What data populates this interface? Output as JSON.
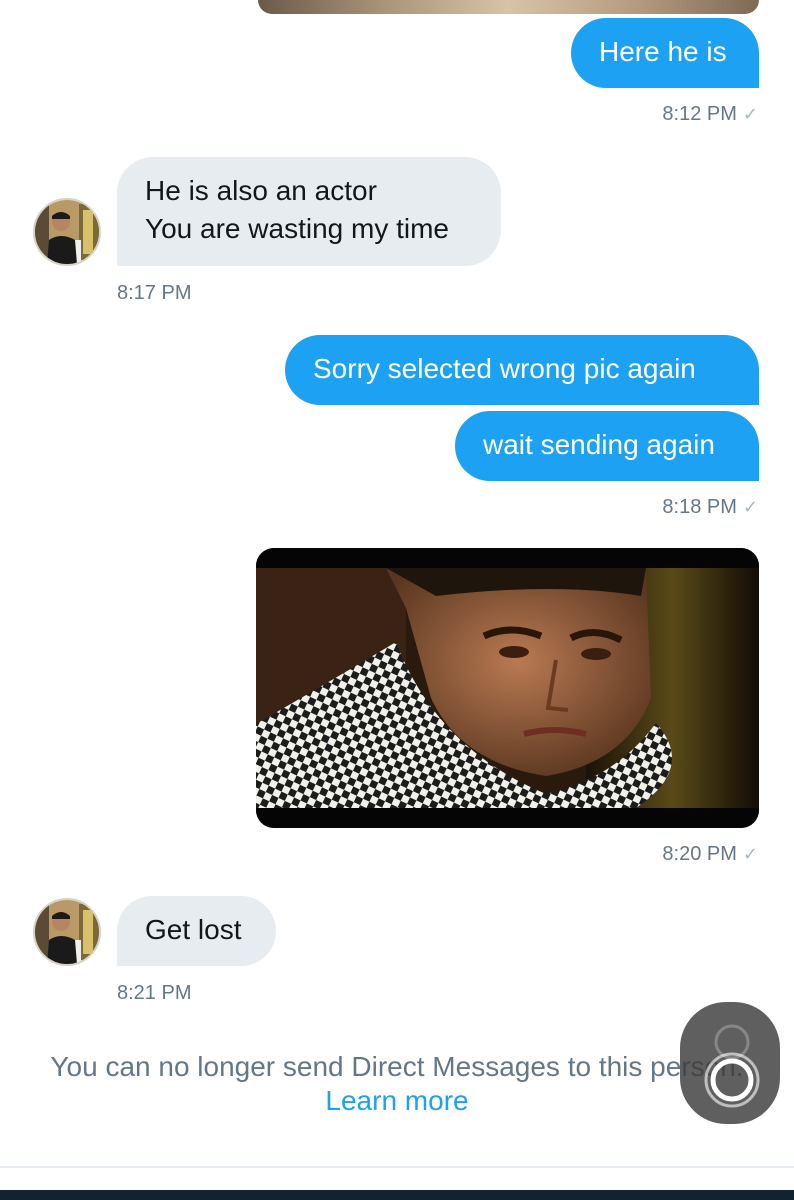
{
  "messages": [
    {
      "id": "m1",
      "direction": "outgoing",
      "lines": [
        "Here he is"
      ],
      "time": "8:12 PM",
      "check": "✓"
    },
    {
      "id": "m2",
      "direction": "incoming",
      "lines": [
        "He is also an actor",
        "You are wasting my time"
      ],
      "time": "8:17 PM"
    },
    {
      "id": "m3",
      "direction": "outgoing",
      "lines": [
        "Sorry selected wrong pic again"
      ]
    },
    {
      "id": "m4",
      "direction": "outgoing",
      "lines": [
        "wait sending again"
      ],
      "time": "8:18 PM",
      "check": "✓"
    },
    {
      "id": "m5",
      "direction": "outgoing",
      "type": "image",
      "time": "8:20 PM",
      "check": "✓"
    },
    {
      "id": "m6",
      "direction": "incoming",
      "lines": [
        "Get lost"
      ],
      "time": "8:21 PM"
    }
  ],
  "notice": {
    "text": "You can no longer send Direct Messages to this person.",
    "learn_more": "Learn more"
  },
  "colors": {
    "outgoing_bubble": "#1da1f2",
    "incoming_bubble": "#e6ecf0",
    "timestamp": "#657786",
    "link": "#1da1f2",
    "bottom_bar": "#10232f"
  },
  "icons": {
    "read_receipt": "check-icon",
    "assistive_touch": "assistive-touch-icon"
  }
}
